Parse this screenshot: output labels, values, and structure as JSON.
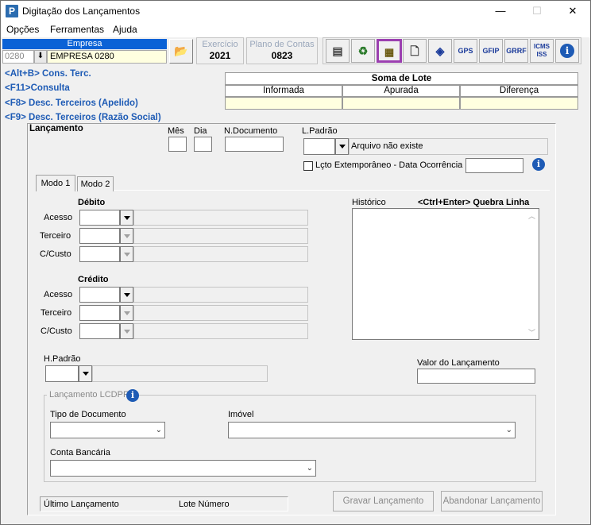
{
  "window": {
    "title": "Digitação dos Lançamentos",
    "app_icon_letter": "P",
    "minimize": "—",
    "maximize": "☐",
    "close": "✕"
  },
  "menu": [
    "Opções",
    "Ferramentas",
    "Ajuda"
  ],
  "empresa": {
    "label": "Empresa",
    "code": "0280",
    "name": "EMPRESA 0280"
  },
  "exercicio": {
    "label": "Exercício",
    "value": "2021"
  },
  "plano_contas": {
    "label": "Plano de Contas",
    "value": "0823"
  },
  "toolbar": [
    "GPS",
    "GFIP",
    "GRRF",
    "ICMS ISS"
  ],
  "shortcuts": [
    "<Alt+B> Cons. Terc.",
    "<F11>Consulta",
    "<F8> Desc. Terceiros (Apelido)",
    "<F9> Desc. Terceiros (Razão Social)"
  ],
  "soma_lote": {
    "title": "Soma de Lote",
    "columns": [
      "Informada",
      "Apurada",
      "Diferença"
    ]
  },
  "lancamento": {
    "section_title": "Lançamento",
    "mes": "Mês",
    "dia": "Dia",
    "ndocumento": "N.Documento",
    "lpadrao": "L.Padrão",
    "arquivo_msg": "Arquivo não existe",
    "extemporaneo": "Lçto Extemporâneo - Data Ocorrência"
  },
  "tabs": [
    "Modo 1",
    "Modo 2"
  ],
  "debito": {
    "title": "Débito",
    "fields": [
      "Acesso",
      "Terceiro",
      "C/Custo"
    ]
  },
  "credito": {
    "title": "Crédito",
    "fields": [
      "Acesso",
      "Terceiro",
      "C/Custo"
    ]
  },
  "historico": {
    "label": "Histórico",
    "hint": "<Ctrl+Enter> Quebra Linha"
  },
  "hpadrao": "H.Padrão",
  "valor_lancamento": "Valor do Lançamento",
  "lcdpr": {
    "title": "Lançamento LCDPR",
    "tipo_documento": "Tipo de Documento",
    "imovel": "Imóvel",
    "conta_bancaria": "Conta Bancária"
  },
  "status": {
    "ultimo": "Último Lançamento",
    "lote": "Lote Número"
  },
  "buttons": {
    "gravar": "Gravar Lançamento",
    "abandonar": "Abandonar Lançamento"
  }
}
